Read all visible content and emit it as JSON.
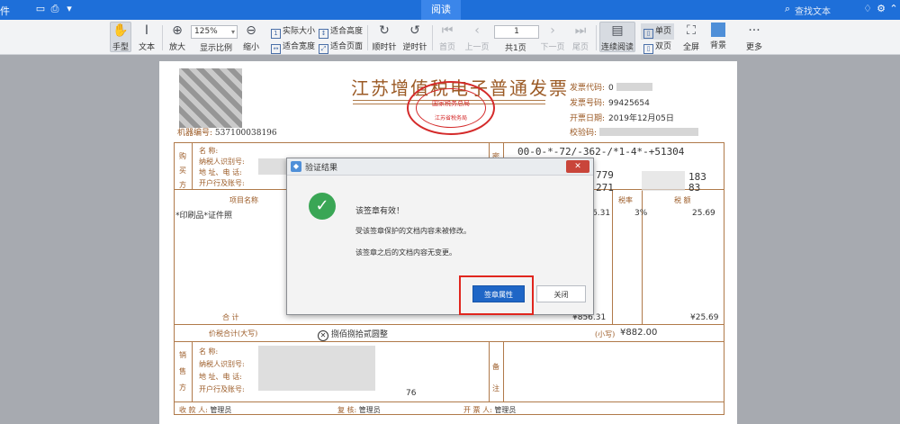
{
  "titlebar": {
    "menu": "件",
    "active_tab": "阅读",
    "search_placeholder": "查找文本"
  },
  "toolbar": {
    "hand": "手型",
    "text": "文本",
    "zoom_in": "放大",
    "zoom_value": "125%",
    "zoom_label": "显示比例",
    "zoom_out": "缩小",
    "actual_size": "实际大小",
    "fit_height": "适合高度",
    "fit_width": "适合宽度",
    "fit_page": "适合页面",
    "rotate_cw": "顺时针",
    "rotate_ccw": "逆时针",
    "first_page": "首页",
    "prev_page": "上一页",
    "page_value": "1",
    "page_total": "共1页",
    "next_page": "下一页",
    "last_page": "尾页",
    "continuous": "连续阅读",
    "single": "单页",
    "double": "双页",
    "fullscreen": "全屏",
    "background": "背景",
    "more": "更多"
  },
  "invoice": {
    "title": "江苏增值税电子普通发票",
    "seal_text_1": "国家税务总局",
    "seal_text_2": "江苏省税务局",
    "machine_label": "机器编号:",
    "machine_no": "537100038196",
    "code_label": "发票代码:",
    "code_value": "0",
    "number_label": "发票号码:",
    "number_value": "99425654",
    "date_label": "开票日期:",
    "date_value": "2019年12月05日",
    "check_label": "校验码:",
    "buyer_side": [
      "购",
      "买",
      "方"
    ],
    "buyer_fields": [
      "名        称:",
      "纳税人识别号:",
      "地 址、电 话:",
      "开户行及账号:"
    ],
    "cipher_side": "密",
    "cipher_lines": [
      "00-0-*-72/-362-/*1-4*-+51304",
      "/+",
      "779",
      "271"
    ],
    "cipher_tail": [
      "183",
      "83"
    ],
    "item_header": "项目名称",
    "item_name": "*印刷品*证件照",
    "tax_rate_header": "税率",
    "tax_header": "税  额",
    "amount_partial": "6.31",
    "tax_rate": "3%",
    "tax_amount": "25.69",
    "total_label": "合      计",
    "total_amount": "¥856.31",
    "total_tax": "¥25.69",
    "price_tax_label": "价税合计(大写)",
    "price_tax_words": "捌佰捌拾贰圆整",
    "price_tax_small_label": "(小写)",
    "price_tax_small": "¥882.00",
    "seller_side": [
      "销",
      "售",
      "方"
    ],
    "seller_fields": [
      "名        称:",
      "纳税人识别号:",
      "地 址、电 话:",
      "开户行及账号:"
    ],
    "seller_account_tail": "76",
    "remark_side": [
      "备",
      "注"
    ],
    "payee_label": "收 款 人:",
    "payee_value": "管理员",
    "reviewer_label": "复     核:",
    "reviewer_value": "管理员",
    "issuer_label": "开 票 人:",
    "issuer_value": "管理员"
  },
  "dialog": {
    "title": "验证结果",
    "close": "✕",
    "message_main": "该签章有效！",
    "message_1": "受该签章保护的文档内容未被修改。",
    "message_2": "该签章之后的文档内容无变更。",
    "btn_properties": "签章属性",
    "btn_close": "关闭"
  }
}
